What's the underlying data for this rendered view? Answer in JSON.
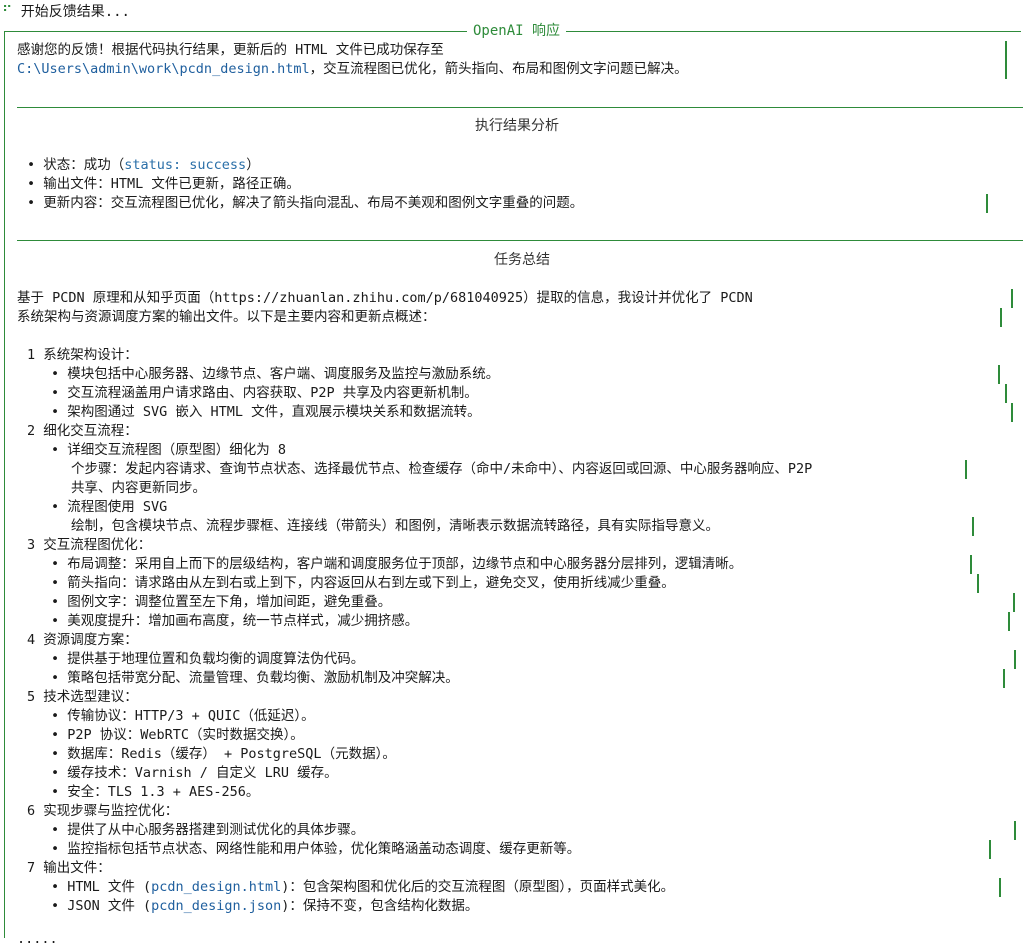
{
  "top_status": {
    "spinner": "⠋",
    "text": "开始反馈结果..."
  },
  "panel": {
    "title": "OpenAI 响应"
  },
  "intro": {
    "line1": "感谢您的反馈！根据代码执行结果，更新后的 HTML 文件已成功保存至",
    "path": "C:\\Users\\admin\\work\\pcdn_design.html",
    "line2_rest": "，交互流程图已优化，箭头指向、布局和图例文字问题已解决。"
  },
  "analysis": {
    "heading": "执行结果分析",
    "items": [
      {
        "prefix": "状态：成功（",
        "code": "status: success",
        "suffix": "）"
      },
      {
        "text": "输出文件：HTML 文件已更新，路径正确。"
      },
      {
        "text": "更新内容：交互流程图已优化，解决了箭头指向混乱、布局不美观和图例文字重叠的问题。"
      }
    ]
  },
  "summary": {
    "heading": "任务总结",
    "para1": "基于 PCDN 原理和从知乎页面（https://zhuanlan.zhihu.com/p/681040925）提取的信息，我设计并优化了 PCDN",
    "para2": "系统架构与资源调度方案的输出文件。以下是主要内容和更新点概述：",
    "sections": [
      {
        "num": "1",
        "title": "系统架构设计：",
        "items": [
          "模块包括中心服务器、边缘节点、客户端、调度服务及监控与激励系统。",
          "交互流程涵盖用户请求路由、内容获取、P2P 共享及内容更新机制。",
          "架构图通过 SVG 嵌入 HTML 文件，直观展示模块关系和数据流转。"
        ]
      },
      {
        "num": "2",
        "title": "细化交互流程：",
        "items": [
          "详细交互流程图（原型图）细化为 8",
          "个步骤：发起内容请求、查询节点状态、选择最优节点、检查缓存（命中/未命中）、内容返回或回源、中心服务器响应、P2P",
          "共享、内容更新同步。",
          "流程图使用 SVG",
          "绘制，包含模块节点、流程步骤框、连接线（带箭头）和图例，清晰表示数据流转路径，具有实际指导意义。"
        ]
      },
      {
        "num": "3",
        "title": "交互流程图优化：",
        "items": [
          "布局调整：采用自上而下的层级结构，客户端和调度服务位于顶部，边缘节点和中心服务器分层排列，逻辑清晰。",
          "箭头指向：请求路由从左到右或上到下，内容返回从右到左或下到上，避免交叉，使用折线减少重叠。",
          "图例文字：调整位置至左下角，增加间距，避免重叠。",
          "美观度提升：增加画布高度，统一节点样式，减少拥挤感。"
        ]
      },
      {
        "num": "4",
        "title": "资源调度方案：",
        "items": [
          "提供基于地理位置和负载均衡的调度算法伪代码。",
          "策略包括带宽分配、流量管理、负载均衡、激励机制及冲突解决。"
        ]
      },
      {
        "num": "5",
        "title": "技术选型建议：",
        "items": [
          "传输协议：HTTP/3 + QUIC（低延迟）。",
          "P2P 协议：WebRTC（实时数据交换）。",
          "数据库：Redis（缓存） + PostgreSQL（元数据）。",
          "缓存技术：Varnish / 自定义 LRU 缓存。",
          "安全：TLS 1.3 + AES-256。"
        ]
      },
      {
        "num": "6",
        "title": "实现步骤与监控优化：",
        "items": [
          "提供了从中心服务器搭建到测试优化的具体步骤。",
          "监控指标包括节点状态、网络性能和用户体验，优化策略涵盖动态调度、缓存更新等。"
        ]
      },
      {
        "num": "7",
        "title": "输出文件：",
        "items": [
          {
            "prefix": "HTML 文件 (",
            "code": "pcdn_design.html",
            "suffix": ")：包含架构图和优化后的交互流程图（原型图），页面样式美化。"
          },
          {
            "prefix": "JSON 文件 (",
            "code": "pcdn_design.json",
            "suffix": ")：保持不变，包含结构化数据。"
          }
        ]
      }
    ]
  },
  "truncated_tail": "....."
}
